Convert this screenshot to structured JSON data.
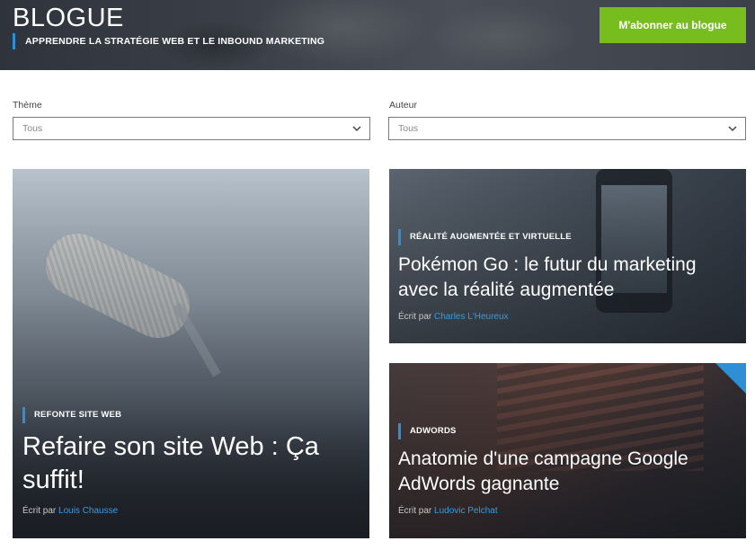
{
  "header": {
    "title": "BLOGUE",
    "subtitle": "APPRENDRE LA STRATÉGIE WEB ET LE INBOUND MARKETING",
    "subscribe_label": "M'abonner au blogue"
  },
  "filters": {
    "theme": {
      "label": "Thème",
      "value": "Tous"
    },
    "author": {
      "label": "Auteur",
      "value": "Tous"
    }
  },
  "posts": [
    {
      "category": "REFONTE SITE WEB",
      "title": "Refaire son site Web : Ça suffit!",
      "byline_prefix": "Écrit par",
      "author": "Louis Chausse"
    },
    {
      "category": "RÉALITÉ AUGMENTÉE ET VIRTUELLE",
      "title": "Pokémon Go : le futur du marketing avec la réalité augmentée",
      "byline_prefix": "Écrit par",
      "author": "Charles L'Heureux"
    },
    {
      "category": "ADWORDS",
      "title": "Anatomie d'une campagne Google AdWords gagnante",
      "byline_prefix": "Écrit par",
      "author": "Ludovic Pelchat"
    }
  ],
  "colors": {
    "accent_blue": "#2d8fd5",
    "subscribe_green": "#76bd1d",
    "author_link": "#3a9ae0"
  },
  "icons": {
    "select_chevron": "chevron-down-icon"
  }
}
